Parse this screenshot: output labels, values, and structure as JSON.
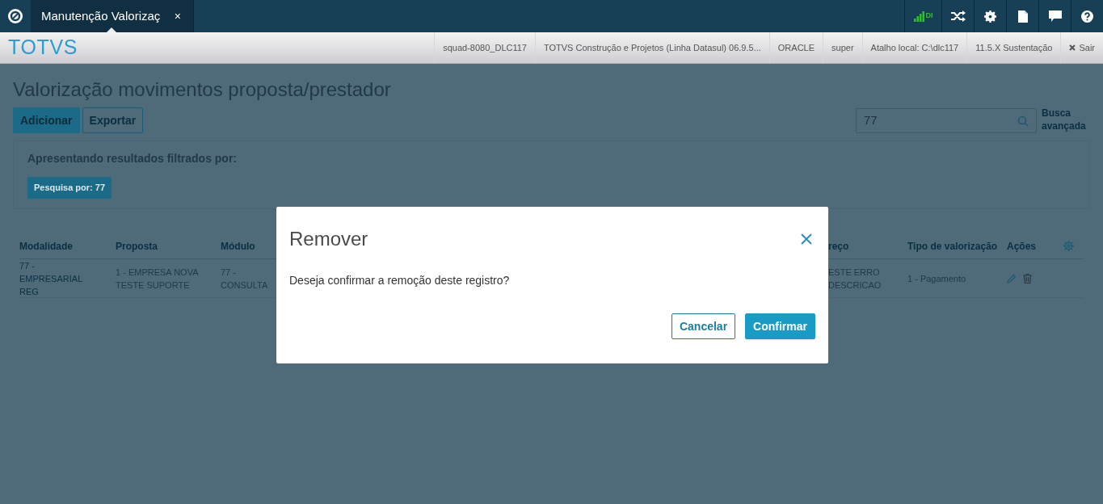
{
  "tab": {
    "title": "Manutenção Valorizaç",
    "close": "×"
  },
  "top_icons": [
    {
      "kind": "signal",
      "label": "DI"
    },
    {
      "kind": "shuffle"
    },
    {
      "kind": "gear"
    },
    {
      "kind": "file"
    },
    {
      "kind": "chat"
    },
    {
      "kind": "help"
    }
  ],
  "brand": "TOTVS",
  "info_bar": [
    "squad-8080_DLC117",
    "TOTVS Construção e Projetos (Linha Datasul) 06.9.5...",
    "ORACLE",
    "super",
    "Atalho local: C:\\dlc117",
    "11.5.X Sustentação"
  ],
  "logout": "Sair",
  "page_title": "Valorização movimentos proposta/prestador",
  "actions": [
    {
      "label": "Adicionar",
      "kind": "primary"
    },
    {
      "label": "Exportar",
      "kind": "secondary"
    }
  ],
  "search": {
    "value": "77",
    "advanced": "Busca avançada"
  },
  "filter": {
    "heading": "Apresentando resultados filtrados por:",
    "tags": [
      "Pesquisa por: 77"
    ]
  },
  "table": {
    "columns": [
      "Modalidade",
      "Proposta",
      "Módulo",
      "reço",
      "Tipo de valorização",
      "Ações"
    ],
    "rows": [
      {
        "cells": [
          [
            "77 -",
            "EMPRESARIAL",
            "REG"
          ],
          [
            "1 - EMPRESA NOVA",
            "TESTE SUPORTE"
          ],
          [
            "77 -",
            "CONSULTA"
          ],
          [
            "ESTE ERRO",
            "DESCRICAO"
          ],
          [
            "1 - Pagamento"
          ]
        ]
      }
    ]
  },
  "dialog": {
    "title": "Remover",
    "message": "Deseja confirmar a remoção deste registro?",
    "buttons": [
      {
        "label": "Cancelar",
        "kind": "secondary"
      },
      {
        "label": "Confirmar",
        "kind": "primary"
      }
    ]
  }
}
